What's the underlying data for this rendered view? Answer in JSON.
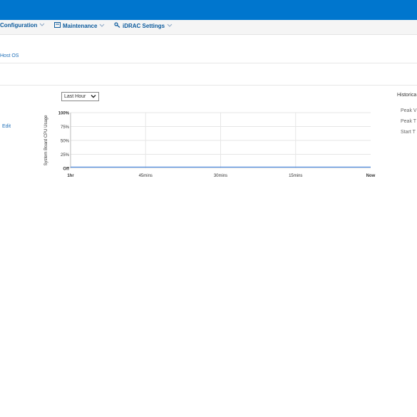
{
  "nav": {
    "items": [
      {
        "label": "Configuration",
        "icon": "none"
      },
      {
        "label": "Maintenance",
        "icon": "maintenance-icon"
      },
      {
        "label": "iDRAC Settings",
        "icon": "key-icon"
      }
    ]
  },
  "tabs": {
    "host_os": "Host OS"
  },
  "controls": {
    "range_select": {
      "value": "Last Hour"
    },
    "edit_link": "Edit"
  },
  "historical": {
    "title": "Historica",
    "items": [
      "Peak V",
      "Peak T",
      "Start T"
    ]
  },
  "colors": {
    "topbar": "#0076ce",
    "line": "#3a7bd5"
  },
  "chart_data": {
    "type": "line",
    "ylabel": "System Board CPU Usage",
    "xlabel": "",
    "ylim": [
      0,
      100
    ],
    "y_ticks": [
      "Off",
      "25%",
      "50%",
      "75%",
      "100%"
    ],
    "x_ticks": [
      "1hr",
      "45mins",
      "30mins",
      "15mins",
      "Now"
    ],
    "series": [
      {
        "values": [
          2,
          2,
          2,
          2,
          2
        ]
      }
    ],
    "grid": true
  }
}
